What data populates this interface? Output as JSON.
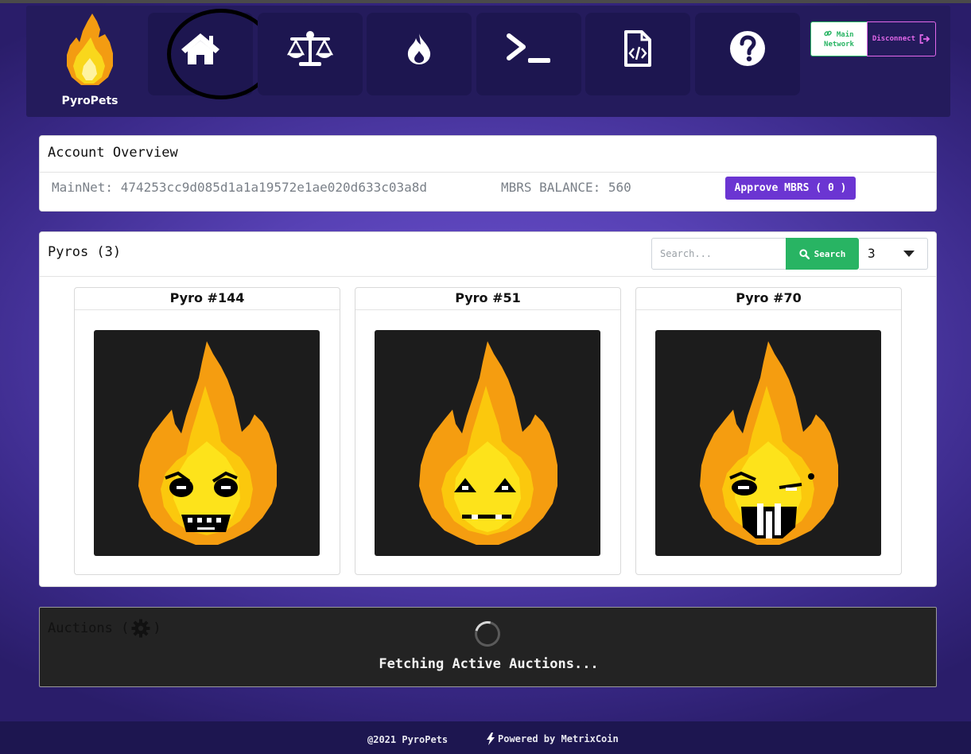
{
  "brand": {
    "name": "PyroPets"
  },
  "nav": {
    "items": [
      {
        "name": "home",
        "icon": "home-icon"
      },
      {
        "name": "scale",
        "icon": "balance-scale-icon"
      },
      {
        "name": "fire",
        "icon": "fire-icon"
      },
      {
        "name": "terminal",
        "icon": "terminal-icon"
      },
      {
        "name": "code-file",
        "icon": "file-code-icon"
      },
      {
        "name": "help",
        "icon": "question-circle-icon"
      }
    ],
    "network_line1": "Main",
    "network_line2": "Network",
    "disconnect_label": "Disconnect"
  },
  "account": {
    "title": "Account Overview",
    "address": "MainNet: 474253cc9d085d1a1a19572e1ae020d633c03a8d",
    "balance": "MBRS BALANCE: 560",
    "approve_label": "Approve MBRS ( 0 )"
  },
  "pyros": {
    "title": "Pyros (3)",
    "search_placeholder": "Search...",
    "search_label": "Search",
    "page_size": "3",
    "items": [
      {
        "name": "Pyro #144"
      },
      {
        "name": "Pyro #51"
      },
      {
        "name": "Pyro #70"
      }
    ]
  },
  "auctions": {
    "title_start": "Auctions (",
    "title_end": ")",
    "loading_text": "Fetching Active Auctions..."
  },
  "footer": {
    "copyright": "@2021 PyroPets",
    "powered": "Powered by MetrixCoin"
  },
  "colors": {
    "nav_bg": "#241b5c",
    "accent_purple": "#6b35d2",
    "success_green": "#28b463",
    "disconnect_pink": "#e268ea",
    "flame_orange": "#f39c12",
    "flame_yellow": "#f9d71c"
  }
}
